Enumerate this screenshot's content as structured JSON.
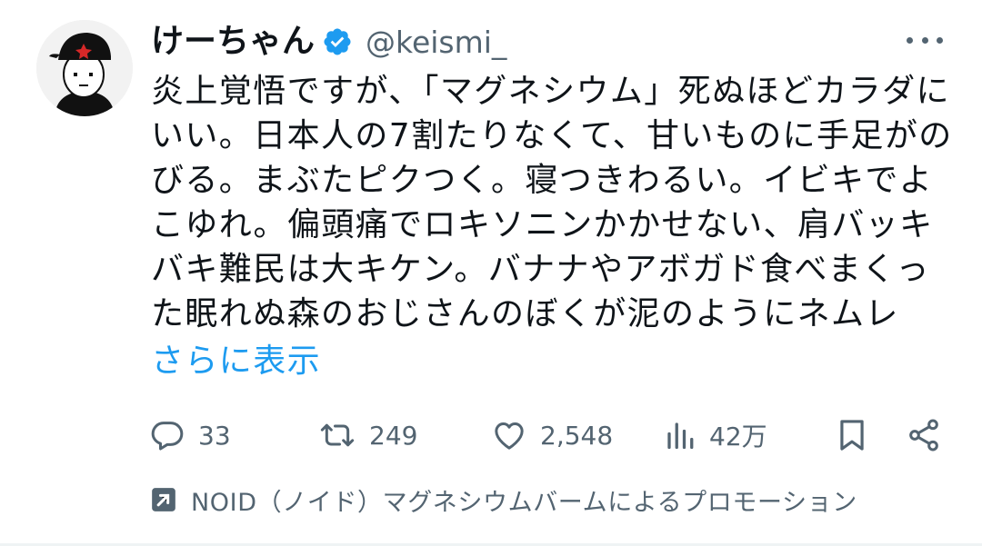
{
  "tweet": {
    "author": {
      "display_name": "けーちゃん",
      "handle": "@keismi_",
      "verified": true
    },
    "text_lines": [
      "炎上覚悟ですが、「マグネシウム」死ぬほどカラダに",
      "いい。日本人の7割たりなくて、甘いものに手足がの",
      "びる。まぶたピクつく。寝つきわるい。イビキでよ",
      "こゆれ。偏頭痛でロキソニンかかせない、肩バッキ",
      "バキ難民は大キケン。バナナやアボガド食べまくっ",
      "た眠れぬ森のおじさんのぼくが泥のようにネムレ"
    ],
    "show_more_label": "さらに表示",
    "metrics": {
      "replies": "33",
      "retweets": "249",
      "likes": "2,548",
      "views": "42万"
    },
    "promotion_label": "NOID（ノイド）マグネシウムバームによるプロモーション"
  },
  "icons": {
    "verified": "verified-badge-icon",
    "more": "more-options-icon",
    "reply": "reply-icon",
    "retweet": "retweet-icon",
    "like": "heart-icon",
    "views": "analytics-icon",
    "bookmark": "bookmark-icon",
    "share": "share-icon",
    "promoted": "promoted-arrow-icon"
  },
  "colors": {
    "text": "#0f1419",
    "secondary": "#536471",
    "link": "#1d9bf0",
    "verified": "#1d9bf0"
  }
}
